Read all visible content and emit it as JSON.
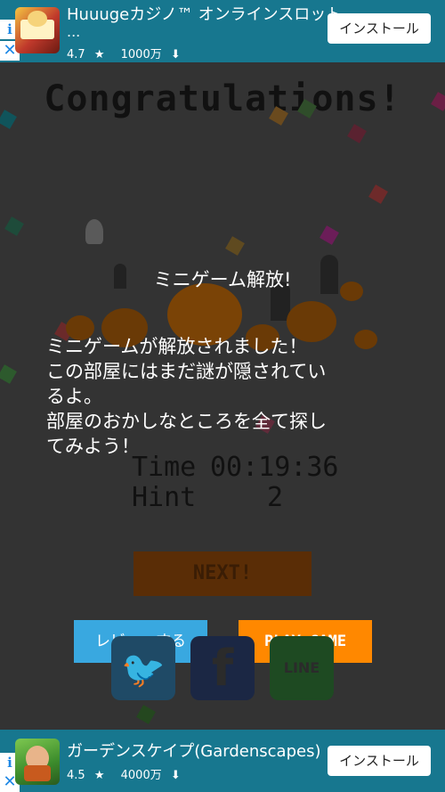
{
  "ad_top": {
    "title": "Huuugeカジノ™ オンラインスロット",
    "subtitle": "...",
    "rating": "4.7",
    "downloads": "1000万",
    "install_label": "インストール"
  },
  "game": {
    "headline": "Congratulations!",
    "unlock_title": "ミニゲーム解放!",
    "unlock_message_lines": [
      "ミニゲームが解放されました！",
      "この部屋にはまだ謎が隠されてい",
      "るよ。",
      "部屋のおかしなところを全て探し",
      "てみよう！"
    ],
    "time_label": "Time",
    "time_value": "00:19:36",
    "hint_label": "Hint",
    "hint_value": "2",
    "next_label": "NEXT!",
    "review_label": "レビューする",
    "play_label": "PLAY GAME",
    "social": [
      "twitter",
      "facebook",
      "line"
    ],
    "line_text": "LINE"
  },
  "ad_bottom": {
    "title": "ガーデンスケイプ(Gardenscapes)",
    "rating": "4.5",
    "downloads": "4000万",
    "install_label": "インストール"
  },
  "colors": {
    "ad_bg": "#17778f",
    "review_button": "#39a8e0",
    "play_button": "#ff8800",
    "next_button": "#5a2d06",
    "twitter": "#1f4a66",
    "facebook": "#1b2744",
    "line": "#1e4a22"
  }
}
